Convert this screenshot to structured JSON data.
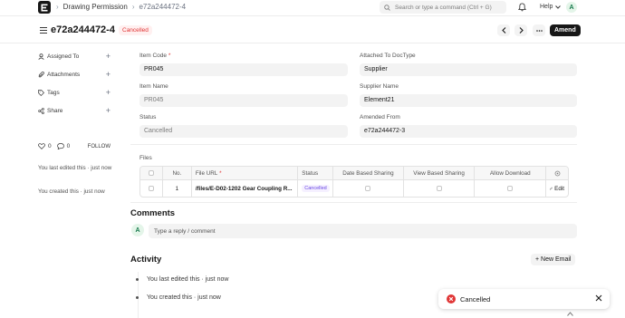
{
  "navbar": {
    "breadcrumb": [
      "Drawing Permission",
      "e72a244472-4"
    ],
    "search_placeholder": "Search or type a command (Ctrl + G)",
    "help_label": "Help",
    "avatar_initial": "A"
  },
  "page": {
    "title": "e72a244472-4",
    "status": "Cancelled",
    "amend_label": "Amend"
  },
  "sidebar": {
    "items": [
      {
        "label": "Assigned To",
        "icon": "user-icon"
      },
      {
        "label": "Attachments",
        "icon": "paperclip-icon"
      },
      {
        "label": "Tags",
        "icon": "tag-icon"
      },
      {
        "label": "Share",
        "icon": "share-icon"
      }
    ],
    "likes": "0",
    "comments_count": "0",
    "follow_label": "FOLLOW",
    "last_edited": "You last edited this · just now",
    "created": "You created this · just now"
  },
  "form": {
    "item_code": {
      "label": "Item Code",
      "value": "PR045"
    },
    "attached_to_doctype": {
      "label": "Attached To DocType",
      "value": "Supplier"
    },
    "item_name": {
      "label": "Item Name",
      "value": "PR045"
    },
    "supplier_name": {
      "label": "Supplier Name",
      "value": "Element21"
    },
    "status": {
      "label": "Status",
      "value": "Cancelled"
    },
    "amended_from": {
      "label": "Amended From",
      "value": "e72a244472-3"
    }
  },
  "files": {
    "label": "Files",
    "columns": {
      "no": "No.",
      "file_url": "File URL",
      "status": "Status",
      "date_based": "Date Based Sharing",
      "view_based": "View Based Sharing",
      "allow_download": "Allow Download"
    },
    "rows": [
      {
        "no": "1",
        "file_url": "/files/E-D02-1202 Gear Coupling R...",
        "status": "Cancelled",
        "edit_label": "Edit"
      }
    ]
  },
  "comments": {
    "title": "Comments",
    "avatar_initial": "A",
    "placeholder": "Type a reply / comment"
  },
  "activity": {
    "title": "Activity",
    "new_email_label": "+ New Email",
    "items": [
      "You last edited this · just now",
      "You created this · just now"
    ]
  },
  "toast": {
    "message": "Cancelled"
  }
}
